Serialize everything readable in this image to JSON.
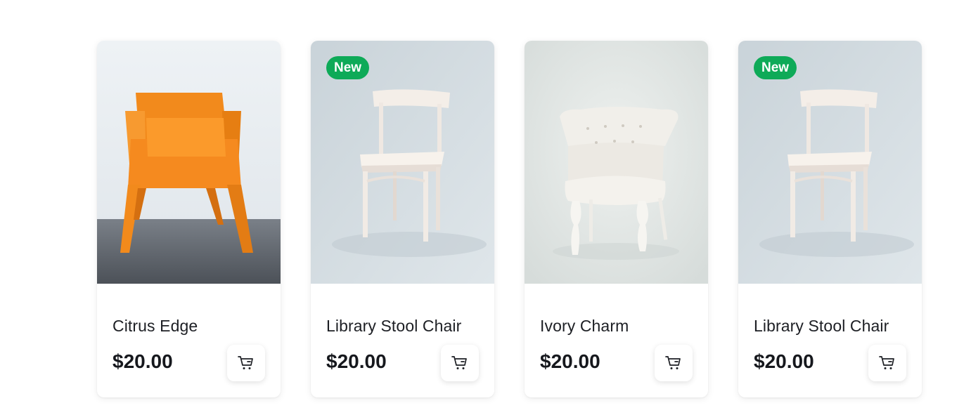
{
  "products": [
    {
      "name": "Citrus Edge",
      "price": "$20.00",
      "badge": "",
      "image": "orange-chair-photo"
    },
    {
      "name": "Library Stool Chair",
      "price": "$20.00",
      "badge": "New",
      "image": "white-wooden-chair-photo"
    },
    {
      "name": "Ivory Charm",
      "price": "$20.00",
      "badge": "",
      "image": "white-tufted-armchair-photo"
    },
    {
      "name": "Library Stool Chair",
      "price": "$20.00",
      "badge": "New",
      "image": "white-wooden-chair-photo"
    }
  ],
  "icons": {
    "cart": "cart-icon"
  },
  "colors": {
    "badge": "#0eaa58",
    "text": "#1d1f24",
    "chair_orange": "#f58a1f"
  }
}
